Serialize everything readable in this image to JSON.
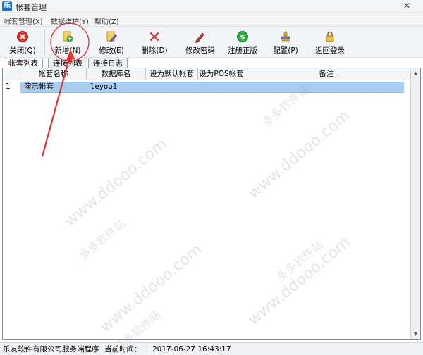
{
  "window": {
    "title": "帐套管理",
    "app_icon_glyph": "乐"
  },
  "menu": [
    "帐套管理(X)",
    "数据维护(Y)",
    "帮助(Z)"
  ],
  "toolbar": {
    "close": "关闭(Q)",
    "add": "新增(N)",
    "edit": "修改(E)",
    "delete": "删除(D)",
    "change_password": "修改密码",
    "register": "注册正版",
    "config": "配置(P)",
    "back_login": "返回登录"
  },
  "tabs": [
    "帐套列表",
    "连接列表",
    "连接日志"
  ],
  "grid": {
    "columns": [
      "帐套名称",
      "数据库名",
      "设为默认帐套",
      "设为POS帐套",
      "备注"
    ],
    "rows": [
      {
        "num": "1",
        "name": "演示帐套",
        "db": "leyou1",
        "default": "",
        "pos": "",
        "note": ""
      }
    ]
  },
  "watermark": {
    "site": "www.ddooo.com",
    "cn": "多多软件站"
  },
  "status": {
    "company": "乐友软件有限公司服务端程序",
    "time_label": "当前时间：",
    "time_value": "2017-06-27 16:43:17"
  },
  "colors": {
    "selected_row": "#a8cdf0",
    "annotation": "#e03030"
  }
}
